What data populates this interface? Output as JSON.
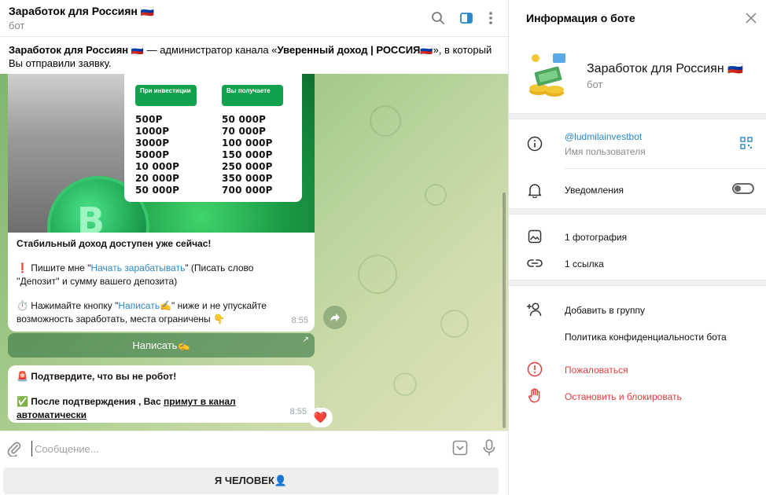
{
  "chat": {
    "title": "Заработок для Россиян 🇷🇺",
    "subtitle": "бот",
    "notice": {
      "part1": "Заработок для Россиян 🇷🇺",
      "part2": " — администратор канала «",
      "channel": "Уверенный доход | РОССИЯ🇷🇺",
      "part3": "», в который",
      "line2": "Вы отправили заявку."
    },
    "media_card": {
      "left_header": "При инвестиции",
      "right_header": "Вы получаете",
      "left_values": [
        "500Р",
        "1000Р",
        "3000Р",
        "5000Р",
        "10 000Р",
        "20 000Р",
        "50 000Р"
      ],
      "right_values": [
        "50 000Р",
        "70 000Р",
        "100 000Р",
        "150 000Р",
        "250 000Р",
        "350 000Р",
        "700 000Р"
      ],
      "coin_symbol": "B"
    },
    "message1": {
      "headline": "Стабильный доход доступен уже сейчас!",
      "line1_prefix": "❗ Пишите мне \"",
      "line1_link": "Начать зарабатывать",
      "line1_suffix": "\"  (Писать слово",
      "line2": "''Депозит'' и сумму вашего депозита)",
      "line3_prefix": "⏱️ Нажимайте кнопку  \"",
      "line3_link": "Написать✍️",
      "line3_suffix": "\" ниже и не упускайте",
      "line4": "возможность заработать, места ограничены 👇",
      "time": "8:55"
    },
    "inline_button": "Написать✍️",
    "message2": {
      "line1": "🚨 Подтвердите, что вы не робот!",
      "line2_prefix": "✅ После подтверждения , Вас ",
      "line2_link": "примут в канал автоматически",
      "time": "8:55",
      "reaction": "❤️"
    },
    "composer_placeholder": "Сообщение...",
    "keyboard_button": "Я ЧЕЛОВЕК👤"
  },
  "info": {
    "title": "Информация о боте",
    "bot_name": "Заработок для Россиян 🇷🇺",
    "bot_sub": "бот",
    "username": "@ludmilainvestbot",
    "username_label": "Имя пользователя",
    "notifications_label": "Уведомления",
    "notifications_on": false,
    "photos": "1 фотография",
    "links": "1 ссылка",
    "add_to_group": "Добавить в группу",
    "privacy": "Политика конфиденциальности бота",
    "report": "Пожаловаться",
    "block": "Остановить и блокировать"
  },
  "colors": {
    "accent": "#2a87c8",
    "danger": "#e0403a",
    "card_green": "#12a14c"
  }
}
